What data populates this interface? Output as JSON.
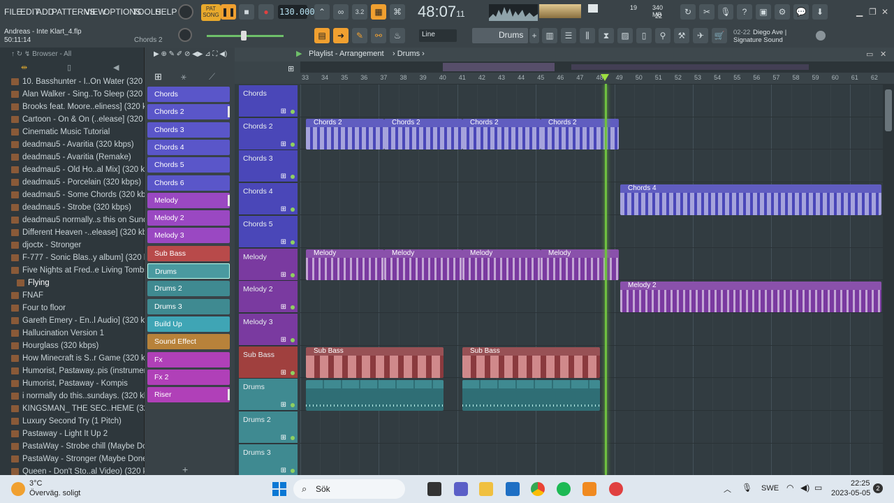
{
  "menu": [
    "FILE",
    "EDIT",
    "ADD",
    "PATTERNS",
    "VIEW",
    "OPTIONS",
    "TOOLS",
    "HELP"
  ],
  "transport": {
    "mode_pat": "PAT",
    "mode_song": "SONG",
    "tempo": "130.000",
    "time": "48:07",
    "time_small": "11",
    "bst": "B:S:T"
  },
  "cpu": {
    "ram": "340 MB",
    "voices": "19",
    "poly": "22"
  },
  "project": {
    "name": "Andreas - Inte Klart_4.flp",
    "time": "50:11:14",
    "channel": "Chords 2"
  },
  "snap": "Line",
  "pattern_selector": "Drums",
  "news": {
    "date": "02-22",
    "text1": "Diego Ave |",
    "text2": "Signature Sound"
  },
  "browser": {
    "title": "Browser - All",
    "items": [
      "10. Basshunter - I..On Water (320 kbps)",
      "Alan Walker - Sing..To Sleep (320 kbps)",
      "Brooks feat. Moore..eliness] (320 kbps)",
      "Cartoon - On & On (..elease] (320 kbps)",
      "Cinematic Music Tutorial",
      "deadmau5 - Avaritia (320 kbps)",
      "deadmau5 - Avaritia (Remake)",
      "deadmau5 - Old Ho..al Mix] (320 kbps)",
      "deadmau5 - Porcelain (320 kbps)",
      "deadmau5 - Some Chords (320 kbps)",
      "deadmau5 - Strobe (320 kbps)",
      "deadmau5 normally..s this on Sundays",
      "Different Heaven -..elease] (320 kbps)",
      "djoctx - Stronger",
      "F-777 - Sonic Blas..y album] (320 kbps)",
      "Five Nights at Fred..e Living Tombstone",
      "Flying",
      "FNAF",
      "Four to floor",
      "Gareth Emery - En..l Audio] (320 kbps)",
      "Hallucination Version 1",
      "Hourglass (320 kbps)",
      "How Minecraft is S..r Game (320 kbps)",
      "Humorist, Pastaway..pis (instrumental)",
      "Humorist, Pastaway - Kompis",
      "i normally do this..sundays. (320 kbps)",
      "KINGSMAN_ THE SEC..HEME (320 kbps)",
      "Luxury Second Try (1 Pitch)",
      "Pastaway - Light It Up 2",
      "PastaWay - Strobe chill (Maybe Done)",
      "PastaWay - Stronger (Maybe Done)",
      "Queen - Don't Sto..al Video) (320 kbps)"
    ]
  },
  "channels": [
    {
      "name": "Chords",
      "color": "#5a56c9"
    },
    {
      "name": "Chords 2",
      "color": "#5a56c9"
    },
    {
      "name": "Chords 3",
      "color": "#5a56c9"
    },
    {
      "name": "Chords 4",
      "color": "#5a56c9"
    },
    {
      "name": "Chords 5",
      "color": "#5a56c9"
    },
    {
      "name": "Chords 6",
      "color": "#5a56c9"
    },
    {
      "name": "Melody",
      "color": "#9a48c2"
    },
    {
      "name": "Melody 2",
      "color": "#9a48c2"
    },
    {
      "name": "Melody 3",
      "color": "#9a48c2"
    },
    {
      "name": "Sub Bass",
      "color": "#b84a4a"
    },
    {
      "name": "Drums",
      "color": "#3f8a91"
    },
    {
      "name": "Drums 2",
      "color": "#3f8a91"
    },
    {
      "name": "Drums 3",
      "color": "#3f8a91"
    },
    {
      "name": "Build Up",
      "color": "#3fa5b5"
    },
    {
      "name": "Sound Effect",
      "color": "#b8823a"
    },
    {
      "name": "Fx",
      "color": "#b040b8"
    },
    {
      "name": "Fx 2",
      "color": "#b040b8"
    },
    {
      "name": "Riser",
      "color": "#b040b8"
    }
  ],
  "playlist": {
    "title": "Playlist - Arrangement",
    "pattern": "Drums",
    "ruler": [
      "33",
      "34",
      "35",
      "36",
      "37",
      "38",
      "39",
      "40",
      "41",
      "42",
      "43",
      "44",
      "45",
      "46",
      "47",
      "48",
      "49",
      "50",
      "51",
      "52",
      "53",
      "54",
      "55",
      "56",
      "57",
      "58",
      "59",
      "60",
      "61",
      "62"
    ],
    "tracks": [
      "Chords",
      "Chords 2",
      "Chords 3",
      "Chords 4",
      "Chords 5",
      "Melody",
      "Melody 2",
      "Melody 3",
      "Sub Bass",
      "Drums",
      "Drums 2",
      "Drums 3"
    ],
    "clips": {
      "chords2": "Chords 2",
      "chords4": "Chords 4",
      "melody": "Melody",
      "melody2": "Melody 2",
      "subbass": "Sub Bass"
    }
  },
  "taskbar": {
    "temp": "3°C",
    "weather": "Överväg. soligt",
    "search": "Sök",
    "lang": "SWE",
    "clock": "22:25",
    "date": "2023-05-05",
    "badge": "2"
  }
}
